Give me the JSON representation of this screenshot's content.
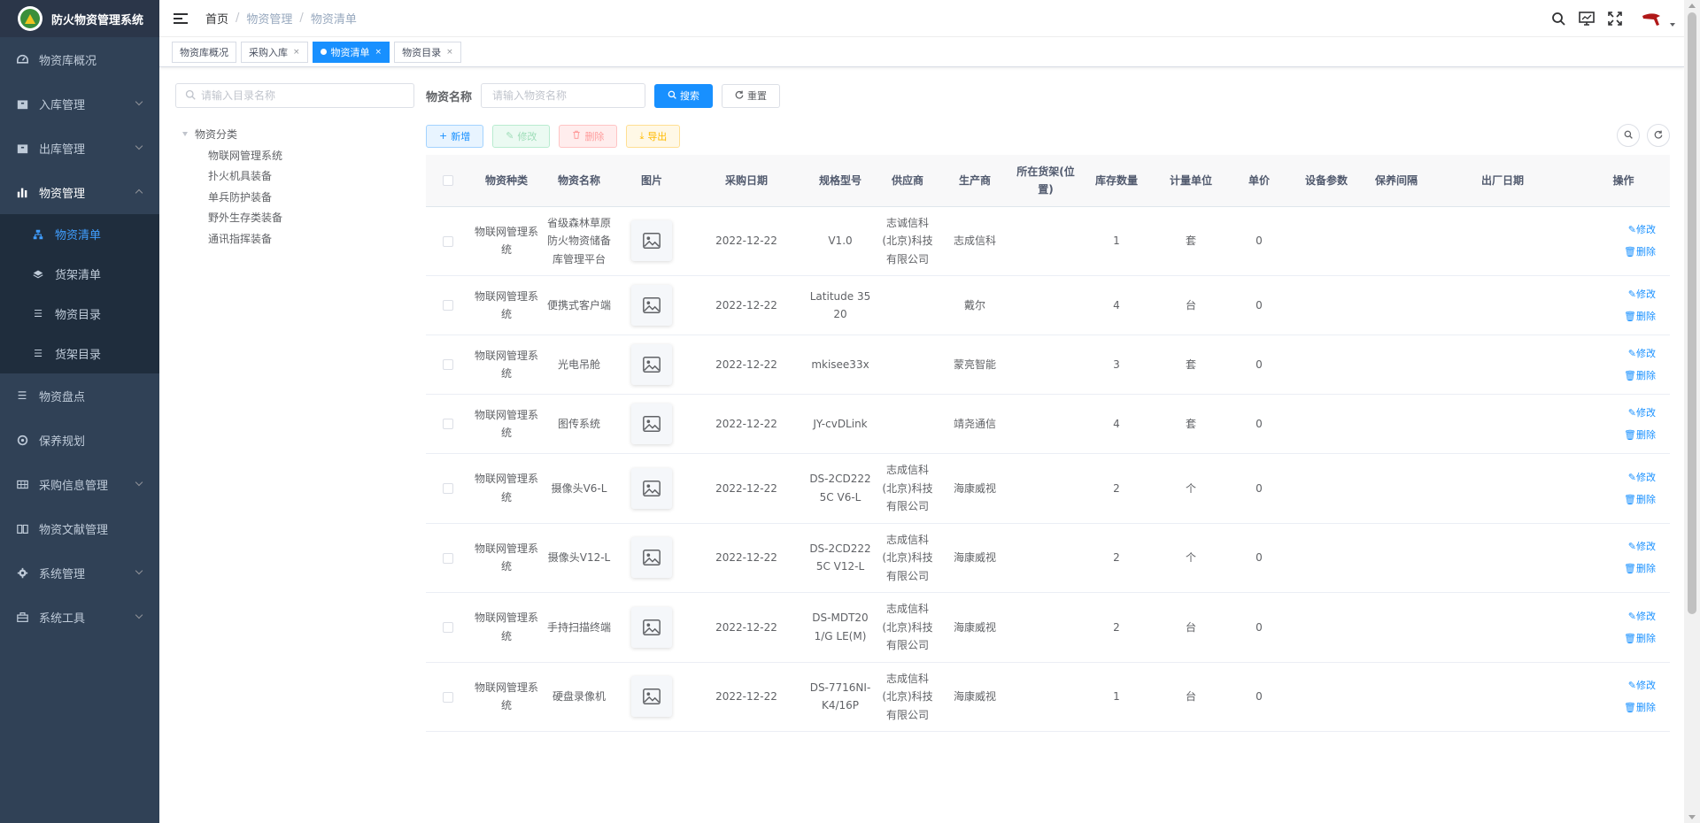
{
  "app": {
    "title": "防火物资管理系统"
  },
  "sidebar": {
    "items": [
      {
        "label": "物资库概况",
        "icon": "dashboard-icon"
      },
      {
        "label": "入库管理",
        "icon": "box-icon"
      },
      {
        "label": "出库管理",
        "icon": "box-out-icon"
      },
      {
        "label": "物资管理",
        "icon": "chart-icon"
      },
      {
        "label": "物资盘点",
        "icon": "list-icon"
      },
      {
        "label": "保养规划",
        "icon": "compass-icon"
      },
      {
        "label": "采购信息管理",
        "icon": "grid-icon"
      },
      {
        "label": "物资文献管理",
        "icon": "book-icon"
      },
      {
        "label": "系统管理",
        "icon": "gear-icon"
      },
      {
        "label": "系统工具",
        "icon": "toolbox-icon"
      }
    ],
    "submenu": [
      {
        "label": "物资清单",
        "icon": "tree-icon"
      },
      {
        "label": "货架清单",
        "icon": "layers-icon"
      },
      {
        "label": "物资目录",
        "icon": "list-icon"
      },
      {
        "label": "货架目录",
        "icon": "list-icon"
      }
    ]
  },
  "breadcrumb": [
    "首页",
    "物资管理",
    "物资清单"
  ],
  "tags": [
    {
      "label": "物资库概况"
    },
    {
      "label": "采购入库"
    },
    {
      "label": "物资清单"
    },
    {
      "label": "物资目录"
    }
  ],
  "tree": {
    "search_placeholder": "请输入目录名称",
    "root": "物资分类",
    "children": [
      "物联网管理系统",
      "扑火机具装备",
      "单兵防护装备",
      "野外生存类装备",
      "通讯指挥装备"
    ]
  },
  "search": {
    "label": "物资名称",
    "placeholder": "请输入物资名称",
    "search_btn": "搜索",
    "reset_btn": "重置"
  },
  "toolbar": {
    "add": "新增",
    "edit": "修改",
    "delete": "删除",
    "export": "导出"
  },
  "table": {
    "headers": [
      "物资种类",
      "物资名称",
      "图片",
      "采购日期",
      "规格型号",
      "供应商",
      "生产商",
      "所在货架(位置)",
      "库存数量",
      "计量单位",
      "单价",
      "设备参数",
      "保养间隔",
      "出厂日期",
      "操作"
    ],
    "op_edit": "修改",
    "op_delete": "删除",
    "rows": [
      {
        "kind": "物联网管理系统",
        "name": "省级森林草原防火物资储备库管理平台",
        "date": "2022-12-22",
        "model": "V1.0",
        "supplier": "志诚信科(北京)科技有限公司",
        "maker": "志成信科",
        "shelf": "",
        "qty": "1",
        "unit": "套",
        "price": "0"
      },
      {
        "kind": "物联网管理系统",
        "name": "便携式客户端",
        "date": "2022-12-22",
        "model": "Latitude 3520",
        "supplier": "",
        "maker": "戴尔",
        "shelf": "",
        "qty": "4",
        "unit": "台",
        "price": "0"
      },
      {
        "kind": "物联网管理系统",
        "name": "光电吊舱",
        "date": "2022-12-22",
        "model": "mkisee33x",
        "supplier": "",
        "maker": "蒙亮智能",
        "shelf": "",
        "qty": "3",
        "unit": "套",
        "price": "0"
      },
      {
        "kind": "物联网管理系统",
        "name": "图传系统",
        "date": "2022-12-22",
        "model": "JY-cvDLink",
        "supplier": "",
        "maker": "靖尧通信",
        "shelf": "",
        "qty": "4",
        "unit": "套",
        "price": "0"
      },
      {
        "kind": "物联网管理系统",
        "name": "摄像头V6-L",
        "date": "2022-12-22",
        "model": "DS-2CD2225C V6-L",
        "supplier": "志成信科(北京)科技有限公司",
        "maker": "海康威视",
        "shelf": "",
        "qty": "2",
        "unit": "个",
        "price": "0"
      },
      {
        "kind": "物联网管理系统",
        "name": "摄像头V12-L",
        "date": "2022-12-22",
        "model": "DS-2CD2225C V12-L",
        "supplier": "志成信科(北京)科技有限公司",
        "maker": "海康威视",
        "shelf": "",
        "qty": "2",
        "unit": "个",
        "price": "0"
      },
      {
        "kind": "物联网管理系统",
        "name": "手持扫描终端",
        "date": "2022-12-22",
        "model": "DS-MDT201/G LE(M)",
        "supplier": "志成信科(北京)科技有限公司",
        "maker": "海康威视",
        "shelf": "",
        "qty": "2",
        "unit": "台",
        "price": "0"
      },
      {
        "kind": "物联网管理系统",
        "name": "硬盘录像机",
        "date": "2022-12-22",
        "model": "DS-7716NI-K4/16P",
        "supplier": "志成信科(北京)科技有限公司",
        "maker": "海康威视",
        "shelf": "",
        "qty": "1",
        "unit": "台",
        "price": "0"
      }
    ]
  }
}
